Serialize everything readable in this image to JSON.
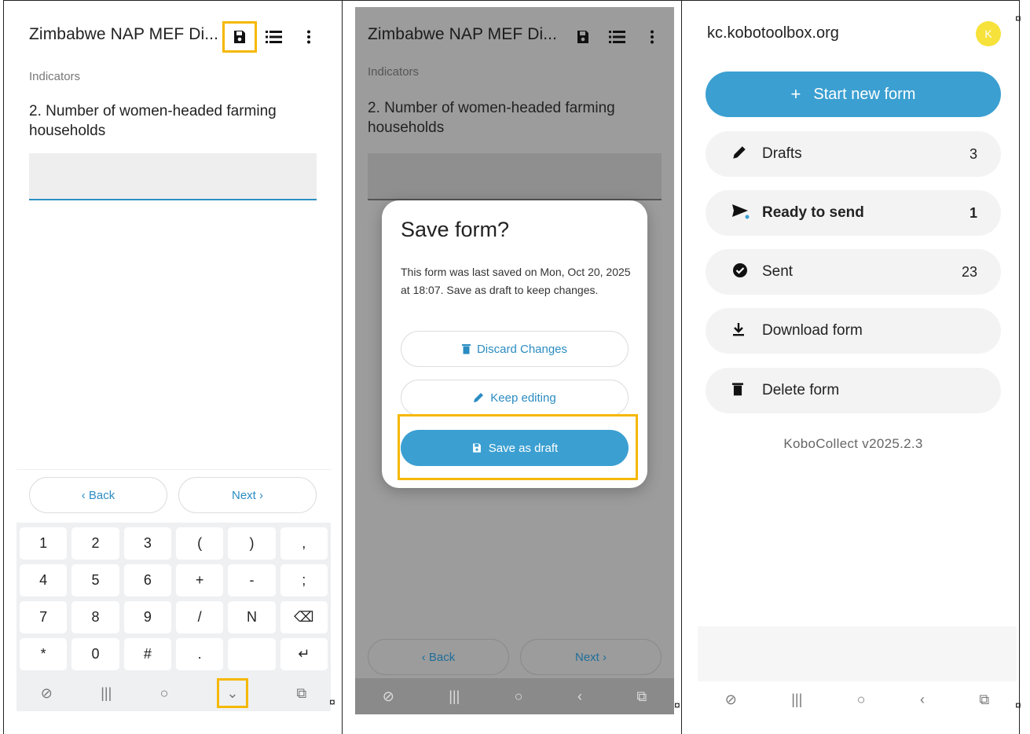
{
  "screen1": {
    "title": "Zimbabwe NAP MEF Di...",
    "group_label": "Indicators",
    "question": "2. Number of women-headed farming households",
    "back_label": "‹  Back",
    "next_label": "Next  ›",
    "keyboard_rows": [
      [
        "1",
        "2",
        "3",
        "(",
        ")",
        ","
      ],
      [
        "4",
        "5",
        "6",
        "+",
        "-",
        ";"
      ],
      [
        "7",
        "8",
        "9",
        "/",
        "N",
        "⌫"
      ],
      [
        "*",
        "0",
        "#",
        ".",
        "",
        "↵"
      ]
    ],
    "system_bar": [
      "⊘",
      "|||",
      "○",
      "⌄",
      "⧉"
    ]
  },
  "screen2": {
    "title": "Zimbabwe NAP MEF Di...",
    "group_label": "Indicators",
    "question": "2. Number of women-headed farming households",
    "dialog_title": "Save form?",
    "dialog_message": "This form was last saved on Mon, Oct 20, 2025 at 18:07. Save as draft to keep changes.",
    "discard_label": "Discard Changes",
    "keep_label": "Keep editing",
    "save_label": "Save as draft",
    "back_label": "‹  Back",
    "next_label": "Next  ›",
    "system_bar": [
      "⊘",
      "|||",
      "○",
      "‹",
      "⧉"
    ]
  },
  "screen3": {
    "server": "kc.kobotoolbox.org",
    "avatar_letter": "K",
    "start_label": "Start new form",
    "menu": [
      {
        "label": "Drafts",
        "count": "3",
        "icon": "pencil-icon"
      },
      {
        "label": "Ready to send",
        "count": "1",
        "icon": "send-icon"
      },
      {
        "label": "Sent",
        "count": "23",
        "icon": "check-circle-icon"
      },
      {
        "label": "Download form",
        "count": "",
        "icon": "download-icon"
      },
      {
        "label": "Delete form",
        "count": "",
        "icon": "trash-icon"
      }
    ],
    "version": "KoboCollect v2025.2.3",
    "system_bar": [
      "⊘",
      "|||",
      "○",
      "‹",
      "⧉"
    ]
  },
  "colors": {
    "accent": "#3b9fd1",
    "highlight": "#f5b800"
  },
  "mark": "¤"
}
